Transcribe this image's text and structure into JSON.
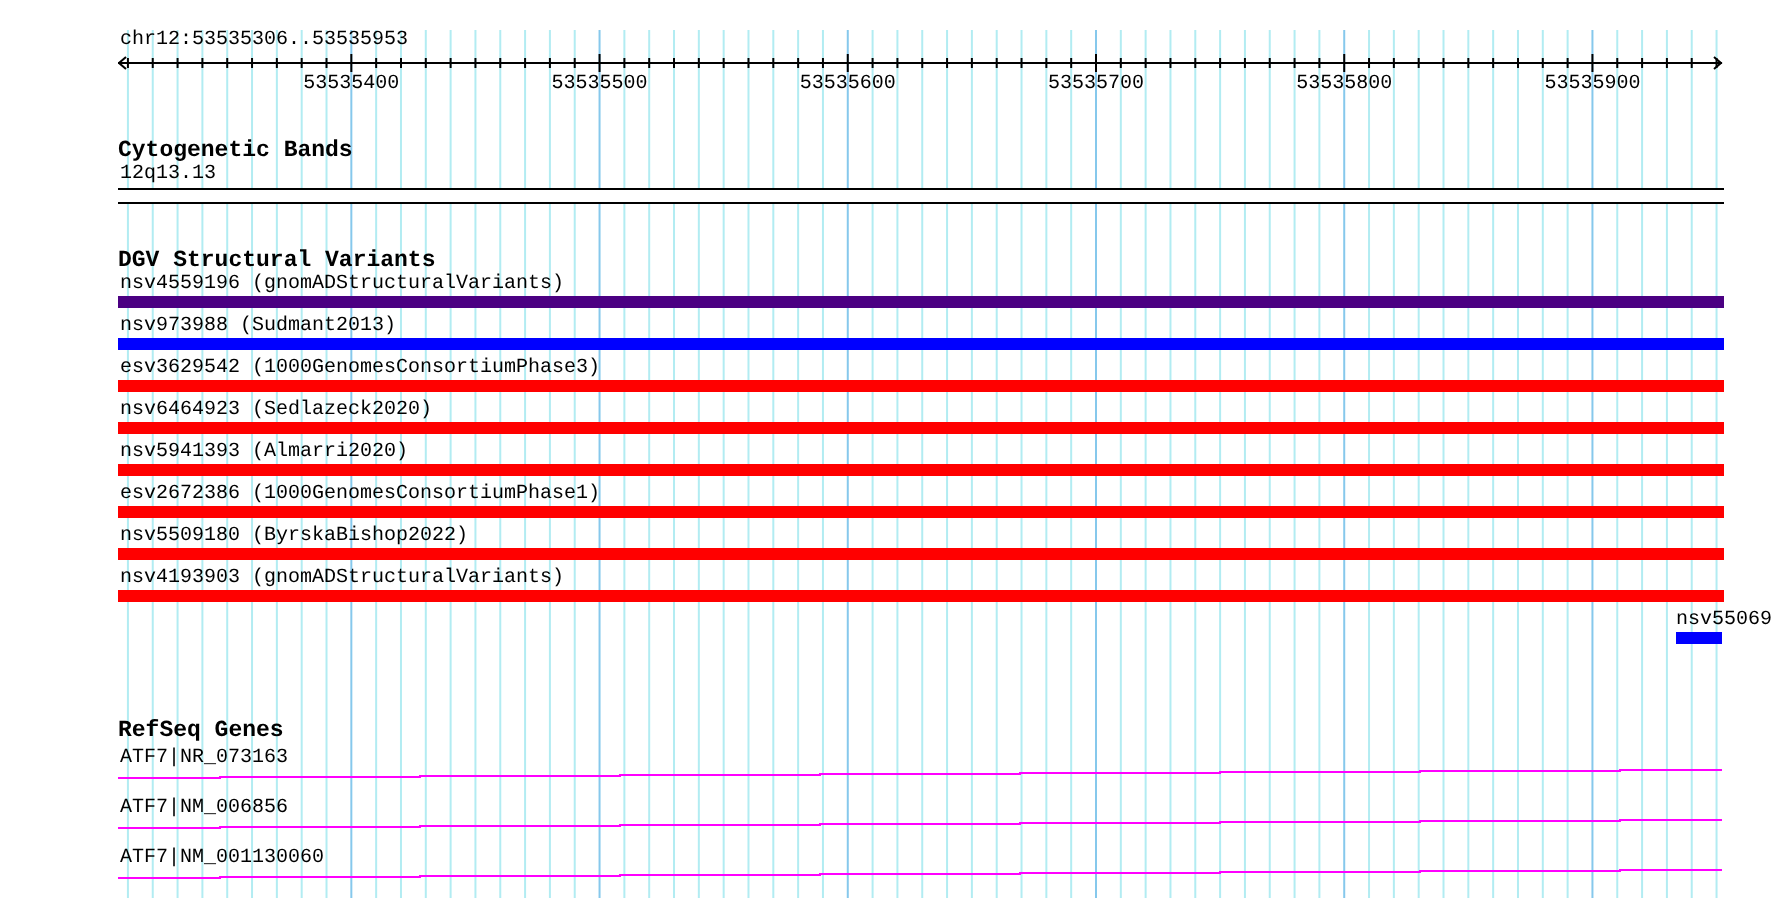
{
  "ruler": {
    "location": "chr12:53535306..53535953",
    "tick_labels": [
      "53535400",
      "53535500",
      "53535600",
      "53535700",
      "53535800",
      "53535900"
    ]
  },
  "cytogenetic_bands": {
    "title": "Cytogenetic Bands",
    "band": "12q13.13"
  },
  "dgv_structural_variants": {
    "title": "DGV Structural Variants",
    "variants": [
      {
        "kind": "span",
        "label": "nsv4559196 (gnomADStructuralVariants)",
        "color": "#4b0082"
      },
      {
        "kind": "span",
        "label": "nsv973988 (Sudmant2013)",
        "color": "#0000ff"
      },
      {
        "kind": "span",
        "label": "esv3629542 (1000GenomesConsortiumPhase3)",
        "color": "#ff0000"
      },
      {
        "kind": "span",
        "label": "nsv6464923 (Sedlazeck2020)",
        "color": "#ff0000"
      },
      {
        "kind": "span",
        "label": "nsv5941393 (Almarri2020)",
        "color": "#ff0000"
      },
      {
        "kind": "span",
        "label": "esv2672386 (1000GenomesConsortiumPhase1)",
        "color": "#ff0000"
      },
      {
        "kind": "span",
        "label": "nsv5509180 (ByrskaBishop2022)",
        "color": "#ff0000"
      },
      {
        "kind": "span",
        "label": "nsv4193903 (gnomADStructuralVariants)",
        "color": "#ff0000"
      },
      {
        "kind": "edge",
        "label": "nsv55069",
        "color": "#0000ff"
      }
    ]
  },
  "refseq_genes": {
    "title": "RefSeq Genes",
    "genes": [
      "ATF7|NR_073163",
      "ATF7|NM_006856",
      "ATF7|NM_001130060"
    ]
  }
}
